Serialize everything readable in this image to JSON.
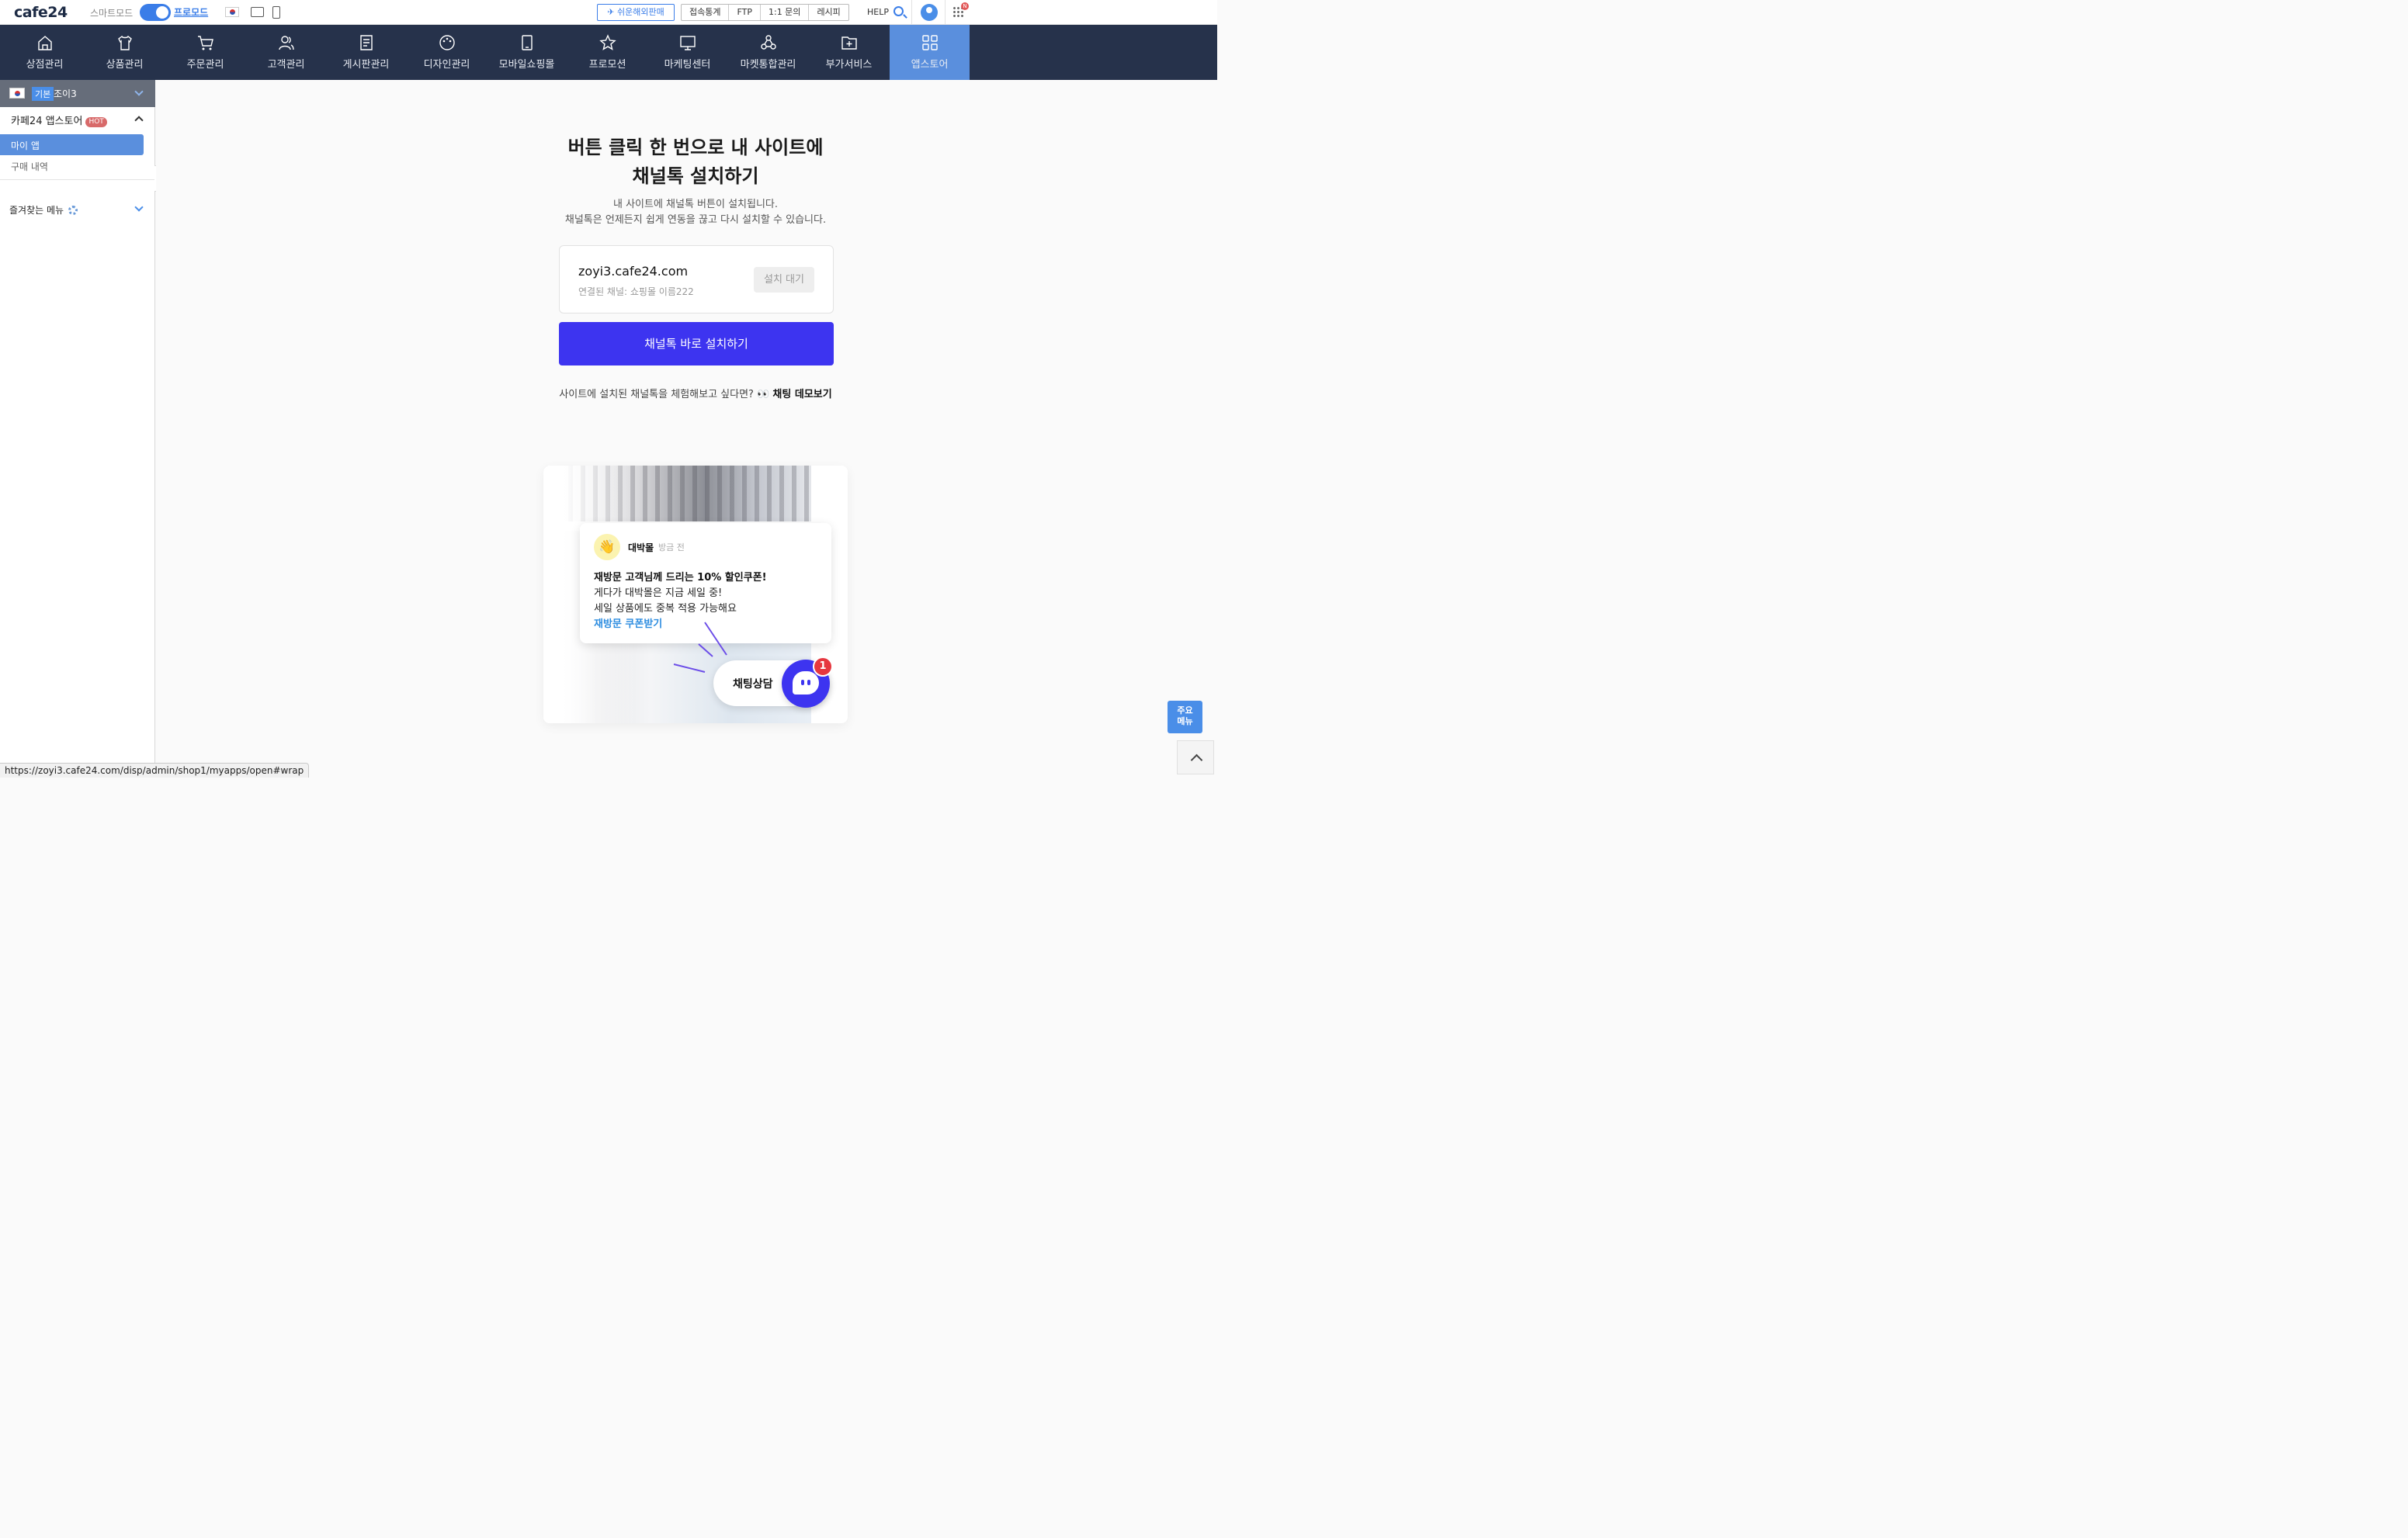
{
  "topbar": {
    "logo": "cafe24",
    "smart_mode": "스마트모드",
    "pro_mode": "프로모드",
    "overseas_btn": "쉬운해외판매",
    "group_buttons": [
      "접속통계",
      "FTP",
      "1:1 문의",
      "레시피"
    ],
    "help": "HELP",
    "apps_badge": "N"
  },
  "nav": {
    "items": [
      {
        "label": "상점관리",
        "icon": "store-icon"
      },
      {
        "label": "상품관리",
        "icon": "shirt-icon"
      },
      {
        "label": "주문관리",
        "icon": "cart-icon"
      },
      {
        "label": "고객관리",
        "icon": "users-icon"
      },
      {
        "label": "게시판관리",
        "icon": "board-icon"
      },
      {
        "label": "디자인관리",
        "icon": "palette-icon"
      },
      {
        "label": "모바일쇼핑몰",
        "icon": "mobile-icon"
      },
      {
        "label": "프로모션",
        "icon": "star-icon"
      },
      {
        "label": "마케팅센터",
        "icon": "monitor-icon"
      },
      {
        "label": "마켓통합관리",
        "icon": "network-icon"
      },
      {
        "label": "부가서비스",
        "icon": "folder-plus-icon"
      },
      {
        "label": "앱스토어",
        "icon": "grid-icon"
      }
    ],
    "active_index": 11
  },
  "sidebar": {
    "shop_tag": "기본",
    "shop_name": "조이3",
    "section_title": "카페24 앱스토어",
    "hot_badge": "HOT",
    "menu_active": "마이 앱",
    "menu_item": "구매 내역",
    "favorites": "즐겨찾는 메뉴"
  },
  "main": {
    "headline_1": "버튼 클릭 한 번으로 내 사이트에",
    "headline_2": "채널톡 설치하기",
    "sub_1": "내 사이트에 채널톡 버튼이 설치됩니다.",
    "sub_2": "채널톡은 언제든지 쉽게 연동을 끊고 다시 설치할 수 있습니다.",
    "card": {
      "domain": "zoyi3.cafe24.com",
      "channel": "연결된 채널: 쇼핑몰 이름222",
      "status": "설치 대기"
    },
    "install_button": "채널톡 바로 설치하기",
    "demo_text": "사이트에 설치된 채널톡을 체험해보고 싶다면? 👀",
    "demo_link": "채팅 데모보기"
  },
  "preview": {
    "sender": "대박몰",
    "time": "방금 전",
    "emoji": "👋",
    "line1": "재방문 고객님께 드리는 10% 할인쿠폰!",
    "line2": "게다가 대박몰은 지금 세일 중!",
    "line3": "세일 상품에도 중복 적용 가능해요",
    "link": "재방문 쿠폰받기",
    "chat_label": "채팅상담",
    "badge_count": "1"
  },
  "floating": {
    "main_menu": "주요 메뉴"
  },
  "status_url": "https://zoyi3.cafe24.com/disp/admin/shop1/myapps/open#wrap"
}
